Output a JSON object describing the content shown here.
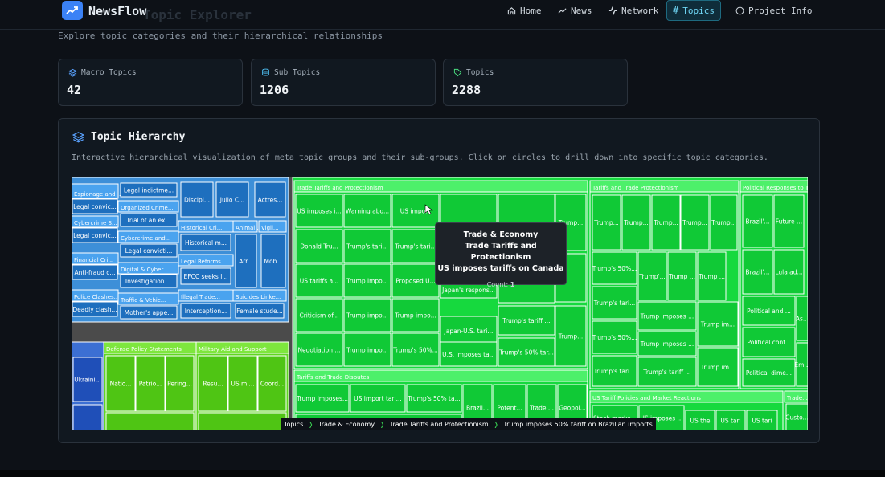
{
  "brand": {
    "name": "NewsFlow",
    "ghost_title": "Topic Explorer"
  },
  "nav": {
    "home": "Home",
    "news": "News",
    "network": "Network",
    "topics": "Topics",
    "project_info": "Project Info"
  },
  "page": {
    "subtitle": "Explore topic categories and their hierarchical relationships"
  },
  "stats": [
    {
      "label": "Macro Topics",
      "value": "42",
      "icon": "layers-icon"
    },
    {
      "label": "Sub Topics",
      "value": "1206",
      "icon": "database-icon"
    },
    {
      "label": "Topics",
      "value": "2288",
      "icon": "tag-icon"
    }
  ],
  "panel": {
    "title": "Topic Hierarchy",
    "description": "Interactive hierarchical visualization of meta topic groups and their sub-groups. Click on circles to drill down into specific topic categories."
  },
  "treemap": {
    "title": "Topic Hierarchy",
    "blue_groups": [
      {
        "header": "Espionage and ...",
        "cells": [
          "Legal convic...",
          "Cybercrime S...",
          "Legal convic...",
          "Financial Cri...",
          "Anti-fraud c...",
          "Police Clashes...",
          "Deadly clash..."
        ]
      },
      {
        "header": "Organized Crime...",
        "cells": [
          "Legal indictme...",
          "Trial of an ex...",
          "Cybercrime and...",
          "Legal convicti...",
          "Digital & Cyber...",
          "Investigation ...",
          "Traffic & Vehic...",
          "Mother's appe..."
        ]
      },
      {
        "header": "Historical Cri...",
        "cells": [
          "Discipl...",
          "Historical m...",
          "Legal Reforms",
          "EFCC seeks l...",
          "Illegal Trade...",
          "Interception..."
        ]
      },
      {
        "header": "Animal...",
        "cells": [
          "Julio C...",
          "Arr...",
          "Suicides Linke...",
          "Female stude..."
        ]
      },
      {
        "header": "Vigil...",
        "cells": [
          "Actres...",
          "Mob..."
        ]
      }
    ],
    "lower_left": [
      {
        "header": "",
        "cells": [
          "Ukraini..."
        ]
      },
      {
        "header": "Defense Policy Statements",
        "cells": [
          "Natio...",
          "Patrio...",
          "Pering..."
        ]
      },
      {
        "header": "Military Aid and Support",
        "cells": [
          "Resu...",
          "US mi...",
          "Coord..."
        ]
      }
    ],
    "green_main": {
      "header": "Trade Tariffs and Protectionism",
      "rows": [
        [
          "US imposes i...",
          "Warning abo...",
          "US impo..."
        ],
        [
          "Donald Tru...",
          "Trump's tari...",
          "Trump's tari..."
        ],
        [
          "US tariffs a...",
          "Trump impo...",
          "Proposed U...",
          "Japan's respons..."
        ],
        [
          "Criticism of...",
          "Trump impo...",
          "Trump impo...",
          "Japan-U.S. tari...",
          "Trump's tariff ..."
        ],
        [
          "Negotiation ...",
          "Trump impo...",
          "Trump's 50%...",
          "U.S. imposes ta...",
          "Trump's 50% tar...",
          "Trump..."
        ]
      ],
      "right_column": [
        "Trump...",
        "Trump..."
      ]
    },
    "green_disputes": {
      "header": "Tariffs and Trade Disputes",
      "cells": [
        "Trump imposes...",
        "US import tari...",
        "Trump's 50% ta...",
        "Brazil...",
        "Potent...",
        "Trade ...",
        "Geopol..."
      ]
    },
    "green_right": {
      "header": "Tariffs and Trade Protectionism",
      "cells": [
        "Trump...",
        "Trump...",
        "Trump...",
        "Trump...",
        "Trump...",
        "Trump's 50%...",
        "Trump'...",
        "Trump ...",
        "Trump ...",
        "Trump's tari...",
        "Trump's 50%...",
        "Trump imposes ...",
        "Trump im...",
        "Trump imposes ...",
        "Trump's tari...",
        "Trump's tariff ...",
        "Trump im..."
      ]
    },
    "green_political": {
      "header": "Political Responses to T...",
      "cells": [
        "Brazil'...",
        "Future ...",
        "Brazil'...",
        "Lula ad...",
        "Political and ...",
        "Political conf...",
        "Political dime...",
        "As...",
        "Em..."
      ]
    },
    "green_bottom": {
      "header": "US Tariff Policies and Market Reactions",
      "cells": [
        "Stock marke...",
        "US imposes ...",
        "US the",
        "US tari",
        "US tari"
      ]
    },
    "green_bottom_right": {
      "header": "Trade...",
      "cells": [
        "Custo..."
      ]
    },
    "faded_labels": [
      "US impose...",
      "US import tari..."
    ]
  },
  "tooltip": {
    "line1": "Trade & Economy",
    "line2": "Trade Tariffs and Protectionism",
    "line3": "US imposes tariffs on Canada",
    "count_label": "Count:",
    "count_value": "1"
  },
  "breadcrumb": [
    "Topics",
    "Trade & Economy",
    "Trade Tariffs and Protectionism",
    "Trump imposes 50% tariff on Brazilian imports"
  ],
  "colors": {
    "background": "#0d1117",
    "accent": "#3b82f6",
    "active_tab": "#6fd6f5",
    "blue_cell": "#1e6fbe",
    "green_cell": "#14d33a",
    "lime_cell": "#55d018"
  }
}
